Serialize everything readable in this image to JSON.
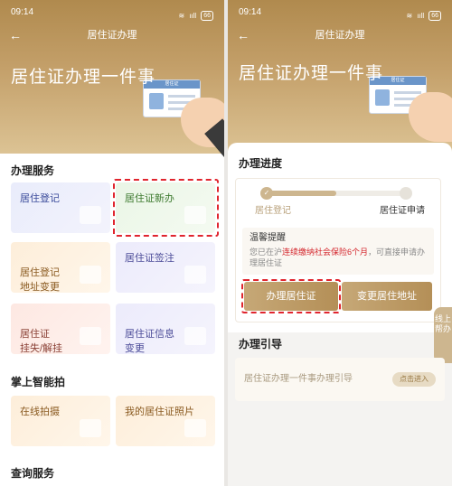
{
  "status": {
    "time": "09:14",
    "signal": "ııll",
    "wifi": "≋",
    "battery": "66"
  },
  "navbar": {
    "title": "居住证办理",
    "back_icon": "arrow-left-icon"
  },
  "hero": {
    "title": "居住证办理一件事",
    "card_header": "居住证"
  },
  "left": {
    "section_services": "办理服务",
    "services": [
      {
        "label": "居住登记"
      },
      {
        "label": "居住证新办"
      },
      {
        "label": "居住登记\n地址变更"
      },
      {
        "label": "居住证签注"
      },
      {
        "label": "居住证\n挂失/解挂"
      },
      {
        "label": "居住证信息\n变更"
      }
    ],
    "section_photo": "掌上智能拍",
    "photo": [
      {
        "label": "在线拍摄"
      },
      {
        "label": "我的居住证照片"
      }
    ],
    "section_query": "查询服务"
  },
  "right": {
    "section_progress": "办理进度",
    "steps": [
      {
        "label": "居住登记"
      },
      {
        "label": "居住证申请"
      }
    ],
    "progress_fraction": 0.5,
    "notice_title": "温馨提醒",
    "notice_pre": "您已在沪",
    "notice_highlight": "连续缴纳社会保险6个月",
    "notice_post": "，可直接申请办理居住证",
    "btn_apply": "办理居住证",
    "btn_change": "变更居住地址",
    "side_help": "线上帮办",
    "section_guide": "办理引导",
    "guide_text": "居住证办理一件事办理引导",
    "guide_button": "点击进入"
  },
  "colors": {
    "accent_gold": "#b48f57",
    "highlight_red": "#d4242b",
    "annotation_red": "#e0252e"
  }
}
